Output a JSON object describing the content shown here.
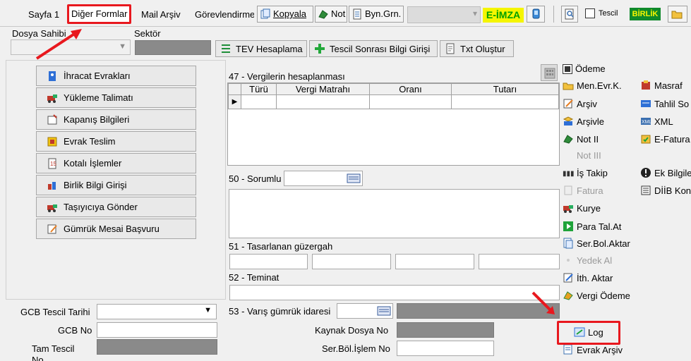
{
  "tabs": [
    "Sayfa 1",
    "Diğer Formlar",
    "Mail Arşiv",
    "Görevlendirme"
  ],
  "toolbar": {
    "kopyala": "Kopyala",
    "not": "Not",
    "byn": "Byn.Grn.",
    "eimza": "E-İMZA",
    "tescil": "Tescil",
    "birlik": "BİRLİK"
  },
  "header_fields": {
    "dosya_sahibi": "Dosya Sahibi",
    "sektor": "Sektör"
  },
  "action_buttons": [
    "TEV Hesaplama",
    "Tescil Sonrası Bilgi Girişi",
    "Txt Oluştur"
  ],
  "left_menu": [
    "İhracat Evrakları",
    "Yükleme Talimatı",
    "Kapanış Bilgileri",
    "Evrak Teslim",
    "Kotalı İşlemler",
    "Birlik Bilgi Girişi",
    "Taşıyıcıya Gönder",
    "Gümrük Mesai Başvuru"
  ],
  "section47": {
    "title": "47 - Vergilerin hesaplanması",
    "columns": [
      "Türü",
      "Vergi Matrahı",
      "Oranı",
      "Tutarı"
    ]
  },
  "section50": "50 - Sorumlu",
  "section51": "51 - Tasarlanan güzergah",
  "section52": "52 - Teminat",
  "section53": "53 - Varış gümrük idaresi",
  "kaynak_dosya": "Kaynak Dosya No",
  "ser_bol": "Ser.Böl.İşlem No",
  "bottom_left": {
    "gcb_tescil": "GCB Tescil Tarihi",
    "gcb_no": "GCB No",
    "tam_tescil": "Tam Tescil",
    "tam_tescil2": "No"
  },
  "right_menu": {
    "odeme": "Ödeme",
    "col1": [
      "Men.Evr.K.",
      "Arşiv",
      "Arşivle",
      "Not II",
      "Not III",
      "İş Takip",
      "Fatura",
      "Kurye",
      "Para Tal.At",
      "Ser.Bol.Aktar",
      "Yedek Al",
      "İth. Aktar",
      "Vergi Ödeme",
      "Log",
      "Evrak Arşiv"
    ],
    "col2": [
      "Masraf",
      "Tahlil So",
      "XML",
      "E-Fatura",
      "Ek Bilgile",
      "DİİB Kont"
    ]
  },
  "colors": {
    "highlight": "#e8181e",
    "eimza_bg": "#f5f500",
    "eimza_fg": "#00a000",
    "birlik_bg": "#0f8a2a"
  }
}
